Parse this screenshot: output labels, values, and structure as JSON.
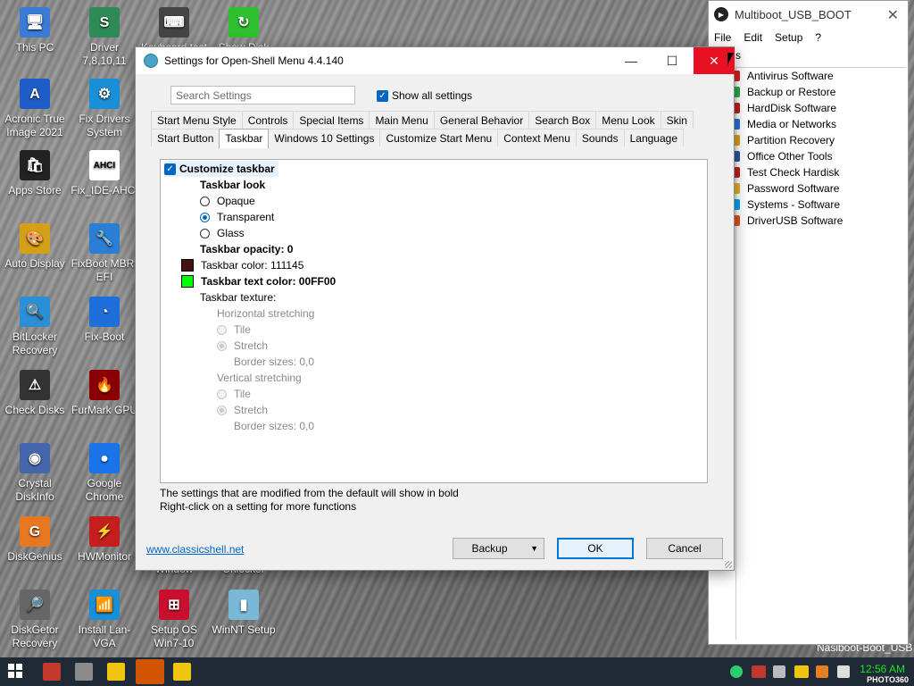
{
  "desktop": {
    "icons": [
      {
        "label": "This PC",
        "color": "#3a7bd5",
        "glyph": "🖥"
      },
      {
        "label": "Driver 7,8,10,11",
        "color": "#2e8b57",
        "glyph": "S"
      },
      {
        "label": "Keyboard test",
        "color": "#444444",
        "glyph": "⌨"
      },
      {
        "label": "Show Disk",
        "color": "#2fbf2f",
        "glyph": "↻"
      },
      {
        "label": "Acronic True Image 2021",
        "color": "#1e5cc8",
        "glyph": "A"
      },
      {
        "label": "Fix Drivers System",
        "color": "#1b8fd6",
        "glyph": "⚙"
      },
      {
        "label": "Apps Store",
        "color": "#222222",
        "glyph": "🛍"
      },
      {
        "label": "Fix_IDE-AHCI",
        "color": "#ffffff",
        "glyph": "AHCI"
      },
      {
        "label": "Auto Display",
        "color": "#d4a017",
        "glyph": "🎨"
      },
      {
        "label": "FixBoot MBR-EFI",
        "color": "#2a7fd4",
        "glyph": "🔧"
      },
      {
        "label": "BitLocker Recovery",
        "color": "#2a8fd4",
        "glyph": "🔍"
      },
      {
        "label": "Fix-Boot",
        "color": "#1e6fd9",
        "glyph": "◔"
      },
      {
        "label": "Check Disks",
        "color": "#333333",
        "glyph": "⚠"
      },
      {
        "label": "FurMark GPU",
        "color": "#8b0000",
        "glyph": "🔥"
      },
      {
        "label": "Crystal DiskInfo",
        "color": "#4466aa",
        "glyph": "◉"
      },
      {
        "label": "Google Chrome",
        "color": "#1a73e8",
        "glyph": "●"
      },
      {
        "label": "DiskGenius",
        "color": "#e87722",
        "glyph": "G"
      },
      {
        "label": "HWMonitor",
        "color": "#c41e1e",
        "glyph": "⚡"
      },
      {
        "label": "DiskGetor Recovery",
        "color": "#666666",
        "glyph": "🔎"
      },
      {
        "label": "Install Lan-VGA",
        "color": "#1b8fd6",
        "glyph": "📶"
      },
      {
        "label": "Setup OS Win7-10",
        "color": "#c8102e",
        "glyph": "⊞"
      },
      {
        "label": "WinNT Setup",
        "color": "#7ab8d8",
        "glyph": "▮"
      },
      {
        "label": "Window",
        "color": "#000000",
        "glyph": ""
      },
      {
        "label": "Unlocker",
        "color": "#000000",
        "glyph": ""
      }
    ],
    "bottom_right_label": "Nasiboot-Boot_USB"
  },
  "multiboot": {
    "title": "Multiboot_USB_BOOT",
    "menu": [
      "File",
      "Edit",
      "Setup",
      "?"
    ],
    "header_fragment": "s",
    "items": [
      {
        "label": "Antivirus Software",
        "color": "#d42020"
      },
      {
        "label": "Backup or Restore",
        "color": "#2aa84a"
      },
      {
        "label": "HardDisk Software",
        "color": "#c02020"
      },
      {
        "label": "Media or Networks",
        "color": "#2a6fd4"
      },
      {
        "label": "Partition Recovery",
        "color": "#d4a017"
      },
      {
        "label": "Office Other Tools",
        "color": "#2b579a"
      },
      {
        "label": "Test Check Hardisk",
        "color": "#c02020"
      },
      {
        "label": "Password Software",
        "color": "#e0b020"
      },
      {
        "label": "Systems - Software",
        "color": "#00a4ef"
      },
      {
        "label": "DriverUSB Software",
        "color": "#e05020"
      }
    ]
  },
  "dialog": {
    "title": "Settings for Open-Shell Menu 4.4.140",
    "search_placeholder": "Search Settings",
    "show_all": "Show all settings",
    "tabs_row1": [
      "Start Menu Style",
      "Controls",
      "Special Items",
      "Main Menu",
      "General Behavior",
      "Search Box",
      "Menu Look",
      "Skin"
    ],
    "tabs_row2": [
      "Start Button",
      "Taskbar",
      "Windows 10 Settings",
      "Customize Start Menu",
      "Context Menu",
      "Sounds",
      "Language"
    ],
    "selected_tab": "Taskbar",
    "settings": {
      "customize_taskbar": "Customize taskbar",
      "taskbar_look": "Taskbar look",
      "opaque": "Opaque",
      "transparent": "Transparent",
      "glass": "Glass",
      "opacity": "Taskbar opacity: 0",
      "color": "Taskbar color: 111145",
      "color_swatch": "#451111",
      "text_color": "Taskbar text color: 00FF00",
      "text_swatch": "#00ff00",
      "texture": "Taskbar texture:",
      "h_stretch": "Horizontal stretching",
      "h_tile": "Tile",
      "h_stretch_opt": "Stretch",
      "h_border": "Border sizes: 0,0",
      "v_stretch": "Vertical stretching",
      "v_tile": "Tile",
      "v_stretch_opt": "Stretch",
      "v_border": "Border sizes: 0,0"
    },
    "hint1": "The settings that are modified from the default will show in bold",
    "hint2": "Right-click on a setting for more functions",
    "link": "www.classicshell.net",
    "backup": "Backup",
    "ok": "OK",
    "cancel": "Cancel"
  },
  "taskbar": {
    "clock": "12:56 AM",
    "watermark": "PHOTO360"
  }
}
